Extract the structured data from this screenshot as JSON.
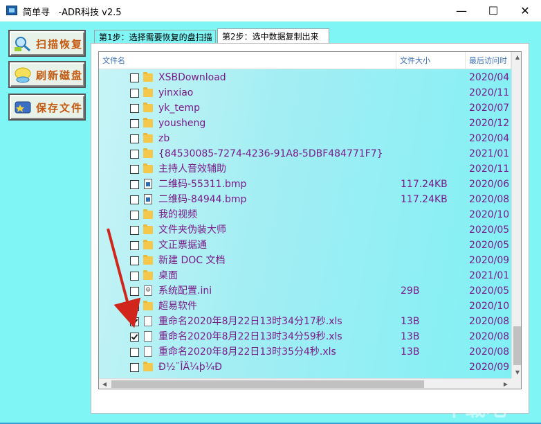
{
  "window": {
    "title": "简单寻   -ADR科技 v2.5",
    "controls": {
      "minimize": "—",
      "maximize": "☐",
      "close": "✕"
    }
  },
  "sidebar": {
    "buttons": [
      {
        "label": "扫描恢复",
        "icon": "scan-icon"
      },
      {
        "label": "刷新磁盘",
        "icon": "refresh-disk-icon"
      },
      {
        "label": "保存文件",
        "icon": "save-file-icon"
      }
    ]
  },
  "tabs": [
    {
      "label": "第1步：选择需要恢复的盘扫描",
      "active": false
    },
    {
      "label": "第2步：选中数据复制出来",
      "active": true
    }
  ],
  "list": {
    "columns": [
      "文件名",
      "文件大小",
      "最后访问时"
    ],
    "rows": [
      {
        "name": "XSBDownload",
        "size": "",
        "date": "2020/04",
        "type": "folder",
        "checked": false
      },
      {
        "name": "yinxiao",
        "size": "",
        "date": "2020/11",
        "type": "folder",
        "checked": false
      },
      {
        "name": "yk_temp",
        "size": "",
        "date": "2020/07",
        "type": "folder",
        "checked": false
      },
      {
        "name": "yousheng",
        "size": "",
        "date": "2020/12",
        "type": "folder",
        "checked": false
      },
      {
        "name": "zb",
        "size": "",
        "date": "2020/04",
        "type": "folder",
        "checked": false
      },
      {
        "name": "{84530085-7274-4236-91A8-5DBF484771F7}",
        "size": "",
        "date": "2021/01",
        "type": "folder",
        "checked": false
      },
      {
        "name": "主持人音效辅助",
        "size": "",
        "date": "2020/11",
        "type": "folder",
        "checked": false
      },
      {
        "name": "二维码-55311.bmp",
        "size": "117.24KB",
        "date": "2020/06",
        "type": "image",
        "checked": false
      },
      {
        "name": "二维码-84944.bmp",
        "size": "117.24KB",
        "date": "2020/08",
        "type": "image",
        "checked": false
      },
      {
        "name": "我的视频",
        "size": "",
        "date": "2020/10",
        "type": "folder",
        "checked": false
      },
      {
        "name": "文件夹伪装大师",
        "size": "",
        "date": "2020/05",
        "type": "folder",
        "checked": false
      },
      {
        "name": "文正票据通",
        "size": "",
        "date": "2020/05",
        "type": "folder",
        "checked": false
      },
      {
        "name": "新建 DOC 文档",
        "size": "",
        "date": "2020/09",
        "type": "folder",
        "checked": false
      },
      {
        "name": "桌面",
        "size": "",
        "date": "2021/01",
        "type": "folder",
        "checked": false
      },
      {
        "name": "系统配置.ini",
        "size": "29B",
        "date": "2020/05",
        "type": "ini",
        "checked": false
      },
      {
        "name": "超易软件",
        "size": "",
        "date": "2020/10",
        "type": "folder",
        "checked": false
      },
      {
        "name": "重命名2020年8月22日13时34分17秒.xls",
        "size": "13B",
        "date": "2020/08",
        "type": "doc",
        "checked": true
      },
      {
        "name": "重命名2020年8月22日13时34分59秒.xls",
        "size": "13B",
        "date": "2020/08",
        "type": "doc",
        "checked": true
      },
      {
        "name": "重命名2020年8月22日13时35分4秒.xls",
        "size": "13B",
        "date": "2020/08",
        "type": "doc",
        "checked": false
      },
      {
        "name": "Ð½¨ÎÄ¼þ¼Ð",
        "size": "",
        "date": "2020/09",
        "type": "folder",
        "checked": false
      }
    ]
  },
  "watermark": "下载吧"
}
